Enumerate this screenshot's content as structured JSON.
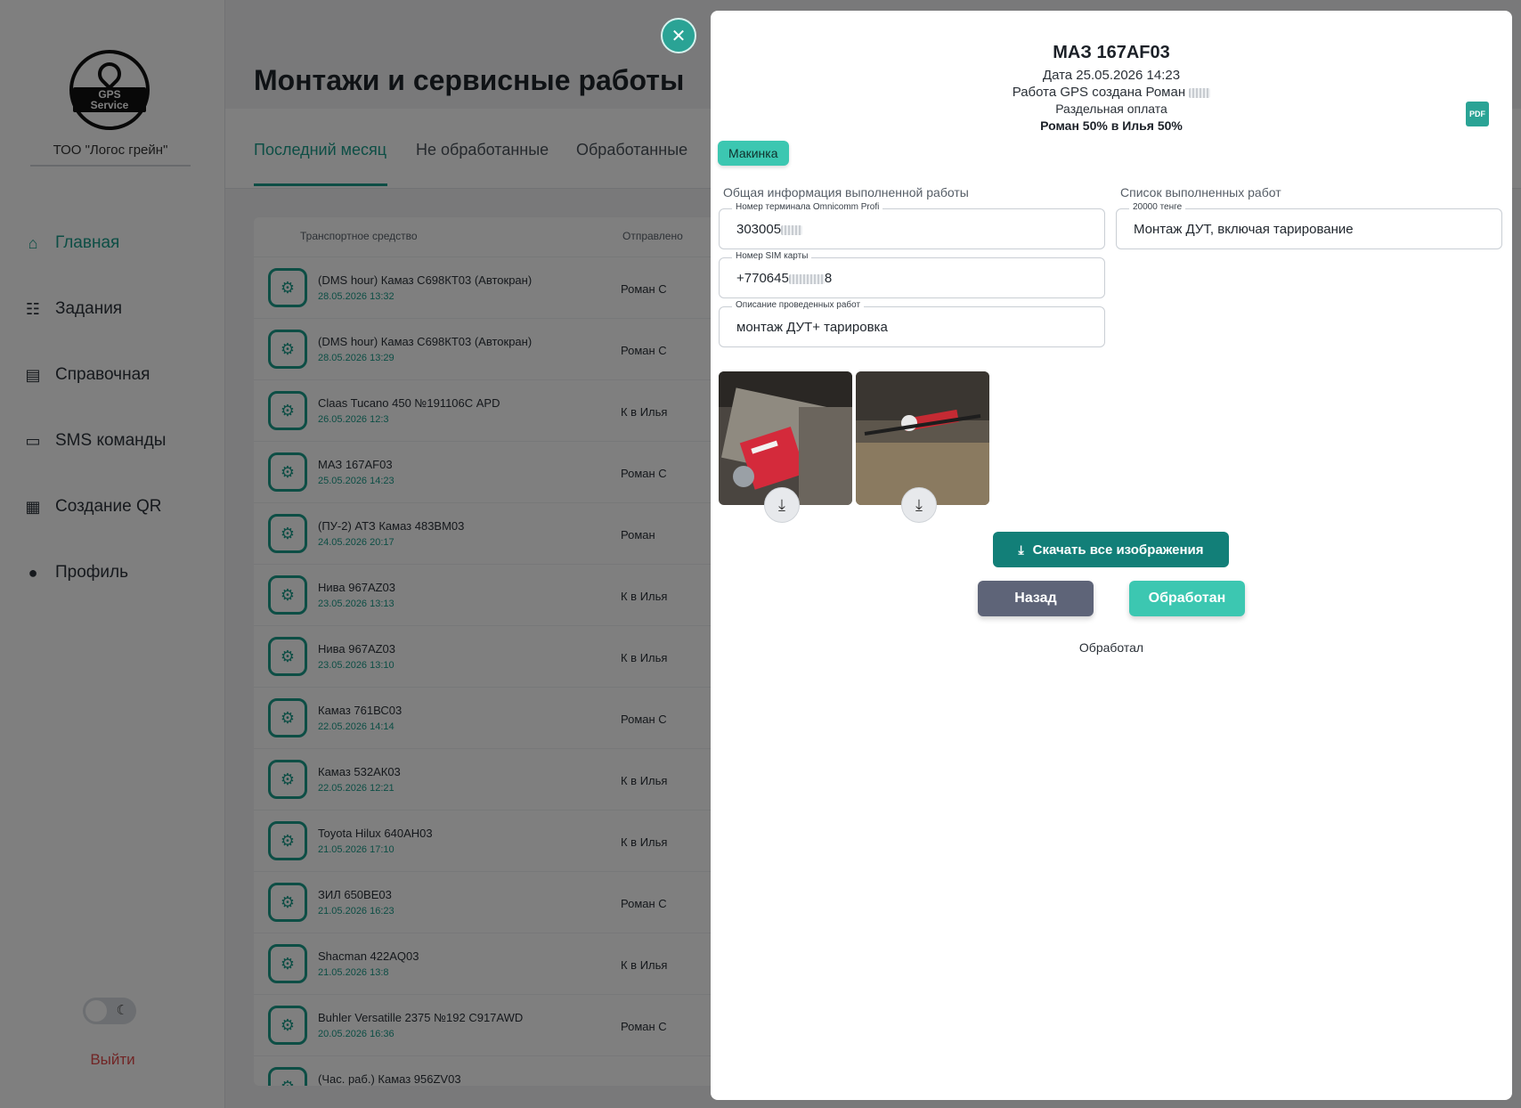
{
  "sidebar": {
    "logo_text": "GPS Service",
    "company": "ТОО \"Логос грейн\"",
    "items": [
      {
        "label": "Главная",
        "icon": "home-icon",
        "active": true
      },
      {
        "label": "Задания",
        "icon": "task-add-icon"
      },
      {
        "label": "Справочная",
        "icon": "document-scan-icon"
      },
      {
        "label": "SMS команды",
        "icon": "chat-icon"
      },
      {
        "label": "Создание QR",
        "icon": "qr-code-icon"
      },
      {
        "label": "Профиль",
        "icon": "person-icon"
      }
    ],
    "logout": "Выйти"
  },
  "main": {
    "title": "Монтажи и сервисные работы",
    "tabs": [
      "Последний месяц",
      "Не обработанные",
      "Обработанные"
    ],
    "table": {
      "headers": [
        "Транспортное средство",
        "Отправлено"
      ],
      "rows": [
        {
          "title": "(DMS hour) Камаз С698КТ03 (Автокран)",
          "date": "28.05.2026 13:32",
          "sender": "Роман С"
        },
        {
          "title": "(DMS hour) Камаз С698КТ03 (Автокран)",
          "date": "28.05.2026 13:29",
          "sender": "Роман С"
        },
        {
          "title": "Claas Tucano 450 №191106С APD",
          "date": "26.05.2026 12:3",
          "sender": "К в Илья"
        },
        {
          "title": "МАЗ 167AF03",
          "date": "25.05.2026 14:23",
          "sender": "Роман С"
        },
        {
          "title": "(ПУ-2) АТЗ Камаз 483ВМ03",
          "date": "24.05.2026 20:17",
          "sender": "Роман"
        },
        {
          "title": "Нива 967AZ03",
          "date": "23.05.2026 13:13",
          "sender": "К в Илья"
        },
        {
          "title": "Нива 967AZ03",
          "date": "23.05.2026 13:10",
          "sender": "К в Илья"
        },
        {
          "title": "Камаз 761ВС03",
          "date": "22.05.2026 14:14",
          "sender": "Роман С"
        },
        {
          "title": "Камаз 532АК03",
          "date": "22.05.2026 12:21",
          "sender": "К в Илья"
        },
        {
          "title": "Toyota Hilux 640AH03",
          "date": "21.05.2026 17:10",
          "sender": "К в Илья"
        },
        {
          "title": "ЗИЛ 650ВЕ03",
          "date": "21.05.2026 16:23",
          "sender": "Роман С"
        },
        {
          "title": "Shacman 422AQ03",
          "date": "21.05.2026 13:8",
          "sender": "К в Илья"
        },
        {
          "title": "Buhler Versatille 2375 №192 С917AWD",
          "date": "20.05.2026 16:36",
          "sender": "Роман С"
        },
        {
          "title": "(Час. раб.) Камаз 956ZV03",
          "date": "",
          "sender": ""
        }
      ]
    }
  },
  "modal": {
    "title": "МАЗ 167AF03",
    "date_line": "Дата 25.05.2026 14:23",
    "created_line": "Работа GPS создана Роман",
    "payment_line": "Раздельная оплата",
    "split_line": "Роман 50%  в Илья 50%",
    "tag": "Макинка",
    "left_section": "Общая информация выполненной работы",
    "right_section": "Список выполненных работ",
    "fields": {
      "terminal_label": "Номер терминала Omnicomm Profi",
      "terminal_value": "303005",
      "sim_label": "Номер SIM карты",
      "sim_value_a": "+770645",
      "sim_value_b": "8",
      "desc_label": "Описание проведенных работ",
      "desc_value": "монтаж ДУТ+ тарировка",
      "work_label": "20000 тенге",
      "work_value": "Монтаж ДУТ, включая тарирование"
    },
    "download_all": "Скачать все изображения",
    "back": "Назад",
    "processed_btn": "Обработан",
    "processed_text": "Обработал",
    "pdf": "PDF",
    "colors": {
      "accent": "#1a9c8a",
      "teal_light": "#3cc7b1",
      "teal_dark": "#127f78",
      "back": "#5e6478"
    }
  }
}
